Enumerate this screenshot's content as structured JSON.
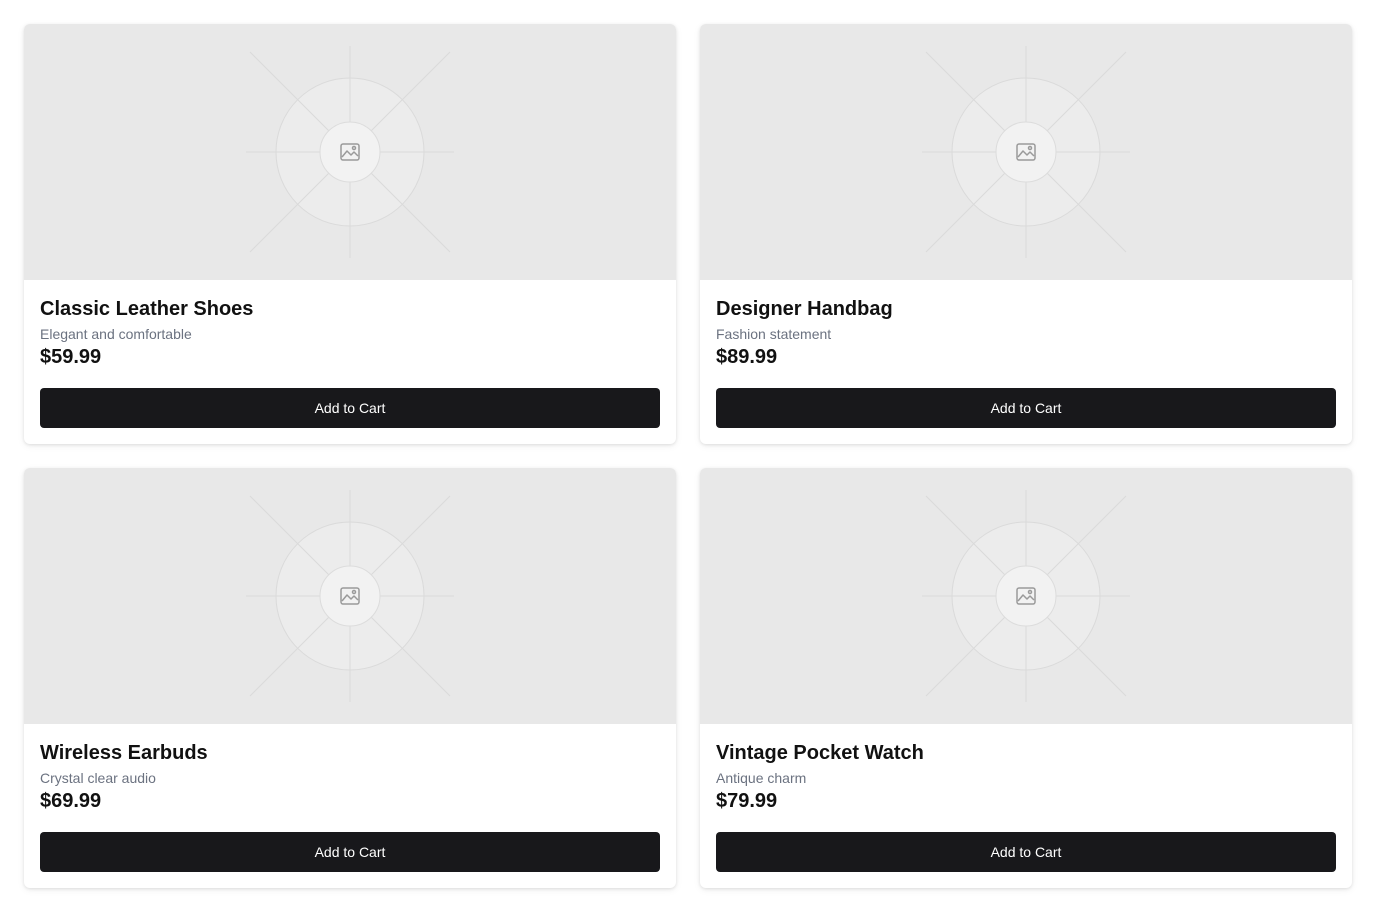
{
  "colors": {
    "placeholder_bg": "#e8e8e8",
    "button_bg": "#18181b",
    "button_text": "#ffffff",
    "subtitle_text": "#6b7280"
  },
  "products": [
    {
      "image_icon": "image-placeholder-icon",
      "title": "Classic Leather Shoes",
      "subtitle": "Elegant and comfortable",
      "price": "$59.99",
      "button_label": "Add to Cart"
    },
    {
      "image_icon": "image-placeholder-icon",
      "title": "Designer Handbag",
      "subtitle": "Fashion statement",
      "price": "$89.99",
      "button_label": "Add to Cart"
    },
    {
      "image_icon": "image-placeholder-icon",
      "title": "Wireless Earbuds",
      "subtitle": "Crystal clear audio",
      "price": "$69.99",
      "button_label": "Add to Cart"
    },
    {
      "image_icon": "image-placeholder-icon",
      "title": "Vintage Pocket Watch",
      "subtitle": "Antique charm",
      "price": "$79.99",
      "button_label": "Add to Cart"
    }
  ]
}
